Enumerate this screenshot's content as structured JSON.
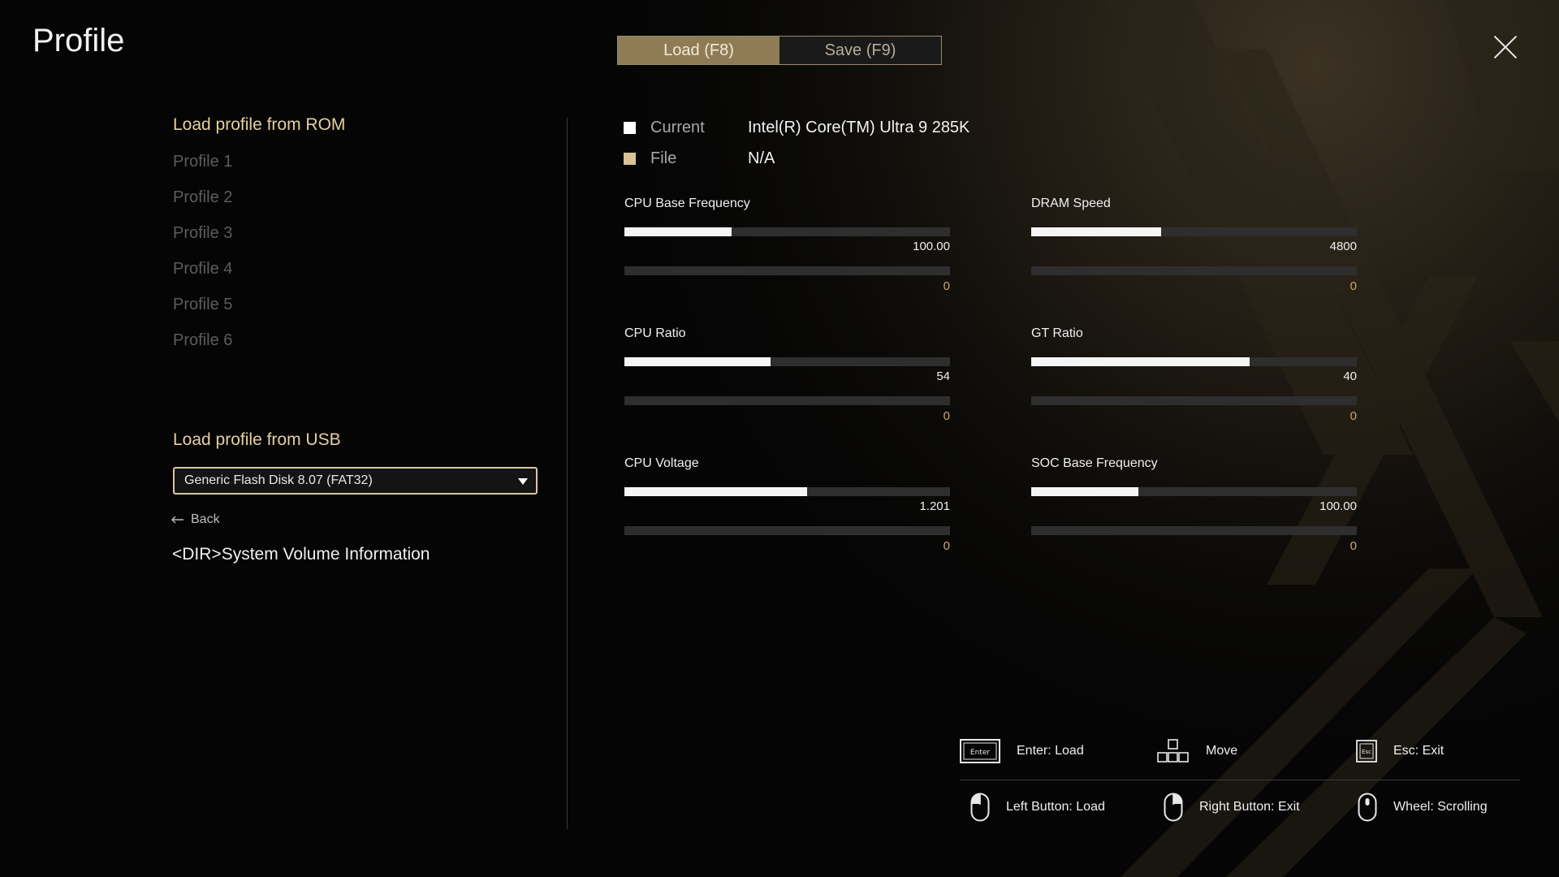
{
  "header": {
    "title": "Profile",
    "tabs": [
      {
        "label": "Load (F8)",
        "active": true
      },
      {
        "label": "Save (F9)",
        "active": false
      }
    ]
  },
  "rom": {
    "heading": "Load profile from ROM",
    "profiles": [
      "Profile 1",
      "Profile 2",
      "Profile 3",
      "Profile 4",
      "Profile 5",
      "Profile 6"
    ]
  },
  "usb": {
    "heading": "Load profile from USB",
    "device": "Generic Flash Disk 8.07 (FAT32)",
    "back_label": "Back",
    "entries": [
      "<DIR>System Volume Information"
    ]
  },
  "legend": {
    "current": {
      "label": "Current",
      "value": "Intel(R) Core(TM) Ultra 9 285K",
      "color": "#ffffff"
    },
    "file": {
      "label": "File",
      "value": "N/A",
      "color": "#d9c296"
    }
  },
  "metrics": [
    {
      "label": "CPU Base Frequency",
      "current": "100.00",
      "current_fraction": 0.33,
      "file": "0"
    },
    {
      "label": "DRAM Speed",
      "current": "4800",
      "current_fraction": 0.4,
      "file": "0"
    },
    {
      "label": "CPU Ratio",
      "current": "54",
      "current_fraction": 0.45,
      "file": "0"
    },
    {
      "label": "GT Ratio",
      "current": "40",
      "current_fraction": 0.67,
      "file": "0"
    },
    {
      "label": "CPU Voltage",
      "current": "1.201",
      "current_fraction": 0.56,
      "file": "0"
    },
    {
      "label": "SOC Base Frequency",
      "current": "100.00",
      "current_fraction": 0.33,
      "file": "0"
    }
  ],
  "hints": [
    {
      "icon": "enter-key-icon",
      "key_text": "Enter",
      "label": "Enter: Load"
    },
    {
      "icon": "arrow-keys-icon",
      "label": "Move"
    },
    {
      "icon": "esc-key-icon",
      "key_text": "Esc",
      "label": "Esc: Exit"
    },
    {
      "icon": "mouse-left-icon",
      "label": "Left Button: Load"
    },
    {
      "icon": "mouse-right-icon",
      "label": "Right Button: Exit"
    },
    {
      "icon": "mouse-wheel-icon",
      "label": "Wheel: Scrolling"
    }
  ],
  "colors": {
    "accent": "#8f7b55",
    "accent_text": "#e6cfa0",
    "file_value": "#c9a96a",
    "background": "#050505"
  }
}
